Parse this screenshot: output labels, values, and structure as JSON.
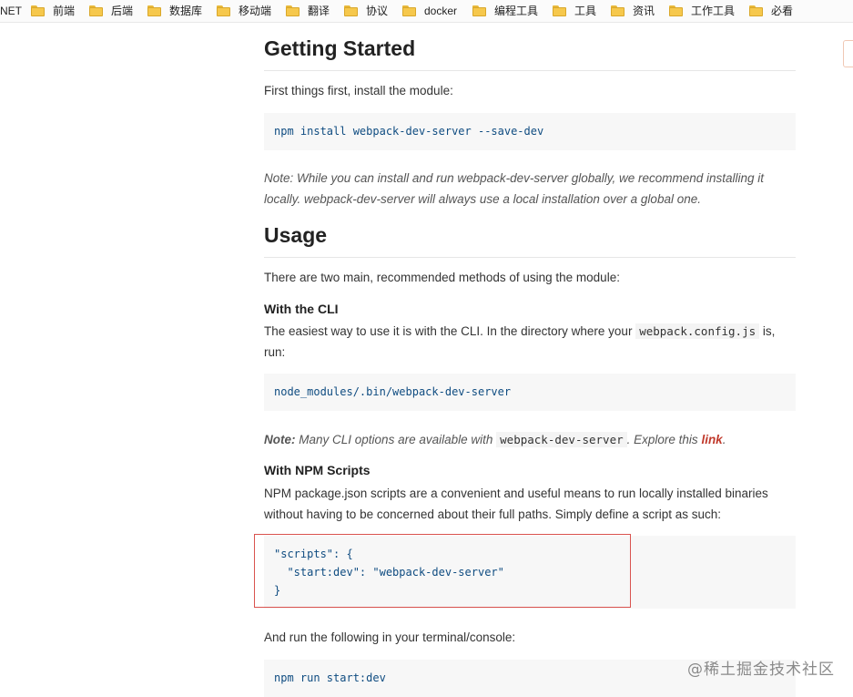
{
  "bookmarks": [
    {
      "label": "NET",
      "icon": "none"
    },
    {
      "label": "前端",
      "icon": "folder-icon"
    },
    {
      "label": "后端",
      "icon": "folder-icon"
    },
    {
      "label": "数据库",
      "icon": "folder-icon"
    },
    {
      "label": "移动端",
      "icon": "folder-icon"
    },
    {
      "label": "翻译",
      "icon": "folder-icon"
    },
    {
      "label": "协议",
      "icon": "folder-icon"
    },
    {
      "label": "docker",
      "icon": "folder-icon"
    },
    {
      "label": "编程工具",
      "icon": "folder-icon"
    },
    {
      "label": "工具",
      "icon": "folder-icon"
    },
    {
      "label": "资讯",
      "icon": "folder-icon"
    },
    {
      "label": "工作工具",
      "icon": "folder-icon"
    },
    {
      "label": "必看",
      "icon": "folder-icon"
    }
  ],
  "getting_started": {
    "heading": "Getting Started",
    "intro": "First things first, install the module:",
    "install_cmd": "npm install webpack-dev-server --save-dev",
    "note_label": "Note:",
    "note_text": "While you can install and run webpack-dev-server globally, we recommend installing it locally. webpack-dev-server will always use a local installation over a global one."
  },
  "usage": {
    "heading": "Usage",
    "intro": "There are two main, recommended methods of using the module:",
    "cli": {
      "heading": "With the CLI",
      "text_before": "The easiest way to use it is with the CLI. In the directory where your",
      "config_file": "webpack.config.js",
      "text_after": "is, run:",
      "cmd": "node_modules/.bin/webpack-dev-server",
      "note_label": "Note:",
      "note_before": "Many CLI options are available with",
      "note_code": "webpack-dev-server",
      "note_after": ". Explore this",
      "note_link": "link",
      "note_end": "."
    },
    "npm_scripts": {
      "heading": "With NPM Scripts",
      "text": "NPM package.json scripts are a convenient and useful means to run locally installed binaries without having to be concerned about their full paths. Simply define a script as such:",
      "code_line1": "\"scripts\": {",
      "code_line2": "  \"start:dev\": \"webpack-dev-server\"",
      "code_line3": "}",
      "run_text": "And run the following in your terminal/console:",
      "run_cmd": "npm run start:dev"
    }
  },
  "watermark": "@稀土掘金技术社区",
  "colors": {
    "code_text": "#0f4c81",
    "code_bg": "#f7f7f7",
    "link": "#c0392b",
    "highlight_border": "#d9534f"
  }
}
